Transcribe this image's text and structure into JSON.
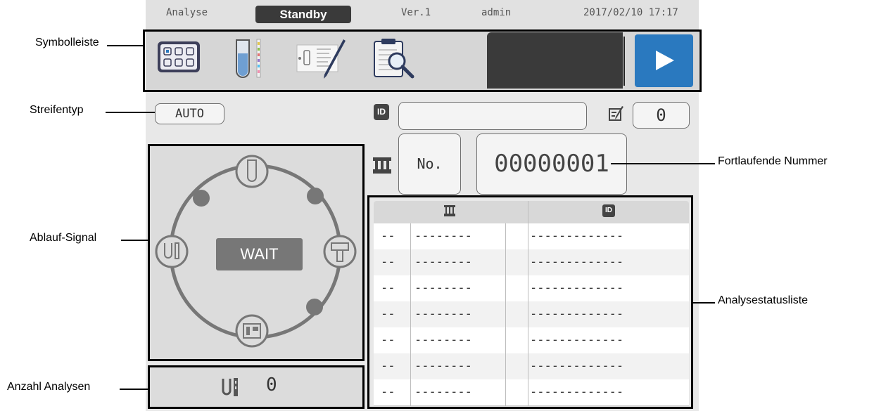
{
  "status_bar": {
    "mode": "Analyse",
    "state": "Standby",
    "version": "Ver.1",
    "user": "admin",
    "datetime": "2017/02/10 17:17"
  },
  "toolbar": {
    "tools": [
      {
        "icon": "strip-grid-icon"
      },
      {
        "icon": "test-tube-strip-icon"
      },
      {
        "icon": "edit-strip-icon"
      },
      {
        "icon": "clipboard-search-icon"
      }
    ],
    "start_icon": "play-icon",
    "start_color": "#2a79bf"
  },
  "strip_type": "AUTO",
  "id_badge": "ID",
  "id_value": "",
  "edit_count": "0",
  "no_label": "No.",
  "sequence_number": "00000001",
  "signal": {
    "center": "WAIT",
    "nodes": [
      "tube-icon",
      "strip-insert-icon",
      "strip-reader-icon",
      "tube-strip-icon"
    ]
  },
  "analyses_count": "0",
  "status_list": {
    "columns": [
      {
        "icon": "rack-icon"
      },
      {
        "icon": "id-icon",
        "label": "ID"
      }
    ],
    "rows": [
      {
        "pos": "--",
        "seq": "--------",
        "mark": "",
        "id": "-------------"
      },
      {
        "pos": "--",
        "seq": "--------",
        "mark": "",
        "id": "-------------"
      },
      {
        "pos": "--",
        "seq": "--------",
        "mark": "",
        "id": "-------------"
      },
      {
        "pos": "--",
        "seq": "--------",
        "mark": "",
        "id": "-------------"
      },
      {
        "pos": "--",
        "seq": "--------",
        "mark": "",
        "id": "-------------"
      },
      {
        "pos": "--",
        "seq": "--------",
        "mark": "",
        "id": "-------------"
      },
      {
        "pos": "--",
        "seq": "--------",
        "mark": "",
        "id": "-------------"
      }
    ]
  },
  "callouts": {
    "toolbar": "Symbolleiste",
    "strip_type": "Streifentyp",
    "flow_signal": "Ablauf-Signal",
    "analyses_count": "Anzahl Analysen",
    "sequence_number": "Fortlaufende Nummer",
    "status_list": "Analysestatusliste"
  }
}
